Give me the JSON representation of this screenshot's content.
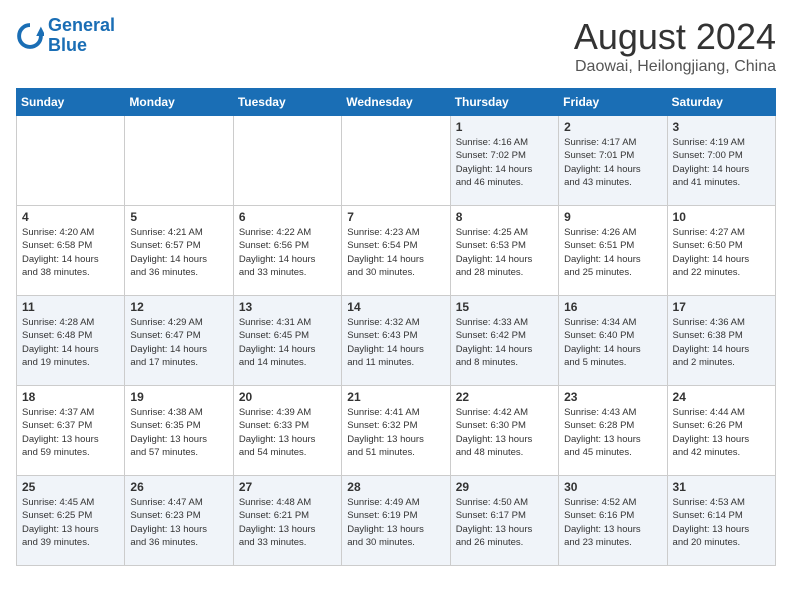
{
  "header": {
    "logo_line1": "General",
    "logo_line2": "Blue",
    "month": "August 2024",
    "location": "Daowai, Heilongjiang, China"
  },
  "weekdays": [
    "Sunday",
    "Monday",
    "Tuesday",
    "Wednesday",
    "Thursday",
    "Friday",
    "Saturday"
  ],
  "weeks": [
    [
      {
        "day": "",
        "info": ""
      },
      {
        "day": "",
        "info": ""
      },
      {
        "day": "",
        "info": ""
      },
      {
        "day": "",
        "info": ""
      },
      {
        "day": "1",
        "info": "Sunrise: 4:16 AM\nSunset: 7:02 PM\nDaylight: 14 hours\nand 46 minutes."
      },
      {
        "day": "2",
        "info": "Sunrise: 4:17 AM\nSunset: 7:01 PM\nDaylight: 14 hours\nand 43 minutes."
      },
      {
        "day": "3",
        "info": "Sunrise: 4:19 AM\nSunset: 7:00 PM\nDaylight: 14 hours\nand 41 minutes."
      }
    ],
    [
      {
        "day": "4",
        "info": "Sunrise: 4:20 AM\nSunset: 6:58 PM\nDaylight: 14 hours\nand 38 minutes."
      },
      {
        "day": "5",
        "info": "Sunrise: 4:21 AM\nSunset: 6:57 PM\nDaylight: 14 hours\nand 36 minutes."
      },
      {
        "day": "6",
        "info": "Sunrise: 4:22 AM\nSunset: 6:56 PM\nDaylight: 14 hours\nand 33 minutes."
      },
      {
        "day": "7",
        "info": "Sunrise: 4:23 AM\nSunset: 6:54 PM\nDaylight: 14 hours\nand 30 minutes."
      },
      {
        "day": "8",
        "info": "Sunrise: 4:25 AM\nSunset: 6:53 PM\nDaylight: 14 hours\nand 28 minutes."
      },
      {
        "day": "9",
        "info": "Sunrise: 4:26 AM\nSunset: 6:51 PM\nDaylight: 14 hours\nand 25 minutes."
      },
      {
        "day": "10",
        "info": "Sunrise: 4:27 AM\nSunset: 6:50 PM\nDaylight: 14 hours\nand 22 minutes."
      }
    ],
    [
      {
        "day": "11",
        "info": "Sunrise: 4:28 AM\nSunset: 6:48 PM\nDaylight: 14 hours\nand 19 minutes."
      },
      {
        "day": "12",
        "info": "Sunrise: 4:29 AM\nSunset: 6:47 PM\nDaylight: 14 hours\nand 17 minutes."
      },
      {
        "day": "13",
        "info": "Sunrise: 4:31 AM\nSunset: 6:45 PM\nDaylight: 14 hours\nand 14 minutes."
      },
      {
        "day": "14",
        "info": "Sunrise: 4:32 AM\nSunset: 6:43 PM\nDaylight: 14 hours\nand 11 minutes."
      },
      {
        "day": "15",
        "info": "Sunrise: 4:33 AM\nSunset: 6:42 PM\nDaylight: 14 hours\nand 8 minutes."
      },
      {
        "day": "16",
        "info": "Sunrise: 4:34 AM\nSunset: 6:40 PM\nDaylight: 14 hours\nand 5 minutes."
      },
      {
        "day": "17",
        "info": "Sunrise: 4:36 AM\nSunset: 6:38 PM\nDaylight: 14 hours\nand 2 minutes."
      }
    ],
    [
      {
        "day": "18",
        "info": "Sunrise: 4:37 AM\nSunset: 6:37 PM\nDaylight: 13 hours\nand 59 minutes."
      },
      {
        "day": "19",
        "info": "Sunrise: 4:38 AM\nSunset: 6:35 PM\nDaylight: 13 hours\nand 57 minutes."
      },
      {
        "day": "20",
        "info": "Sunrise: 4:39 AM\nSunset: 6:33 PM\nDaylight: 13 hours\nand 54 minutes."
      },
      {
        "day": "21",
        "info": "Sunrise: 4:41 AM\nSunset: 6:32 PM\nDaylight: 13 hours\nand 51 minutes."
      },
      {
        "day": "22",
        "info": "Sunrise: 4:42 AM\nSunset: 6:30 PM\nDaylight: 13 hours\nand 48 minutes."
      },
      {
        "day": "23",
        "info": "Sunrise: 4:43 AM\nSunset: 6:28 PM\nDaylight: 13 hours\nand 45 minutes."
      },
      {
        "day": "24",
        "info": "Sunrise: 4:44 AM\nSunset: 6:26 PM\nDaylight: 13 hours\nand 42 minutes."
      }
    ],
    [
      {
        "day": "25",
        "info": "Sunrise: 4:45 AM\nSunset: 6:25 PM\nDaylight: 13 hours\nand 39 minutes."
      },
      {
        "day": "26",
        "info": "Sunrise: 4:47 AM\nSunset: 6:23 PM\nDaylight: 13 hours\nand 36 minutes."
      },
      {
        "day": "27",
        "info": "Sunrise: 4:48 AM\nSunset: 6:21 PM\nDaylight: 13 hours\nand 33 minutes."
      },
      {
        "day": "28",
        "info": "Sunrise: 4:49 AM\nSunset: 6:19 PM\nDaylight: 13 hours\nand 30 minutes."
      },
      {
        "day": "29",
        "info": "Sunrise: 4:50 AM\nSunset: 6:17 PM\nDaylight: 13 hours\nand 26 minutes."
      },
      {
        "day": "30",
        "info": "Sunrise: 4:52 AM\nSunset: 6:16 PM\nDaylight: 13 hours\nand 23 minutes."
      },
      {
        "day": "31",
        "info": "Sunrise: 4:53 AM\nSunset: 6:14 PM\nDaylight: 13 hours\nand 20 minutes."
      }
    ]
  ]
}
